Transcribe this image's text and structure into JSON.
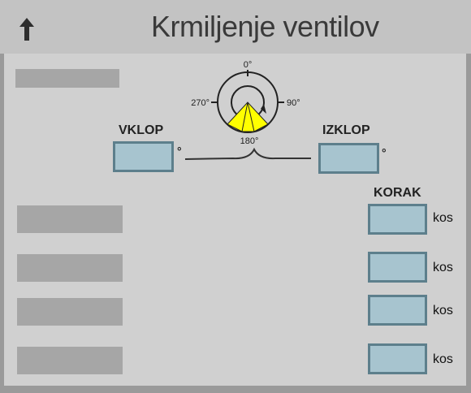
{
  "header": {
    "title": "Krmiljenje ventilov",
    "back_icon": "up-arrow-icon"
  },
  "dial": {
    "label_0": "0°",
    "label_90": "90°",
    "label_180": "180°",
    "label_270": "270°",
    "sector_color": "#ffff00"
  },
  "on": {
    "label": "VKLOP",
    "value": "",
    "unit": "°"
  },
  "off": {
    "label": "IZKLOP",
    "value": "",
    "unit": "°"
  },
  "step": {
    "header": "KORAK",
    "rows": [
      {
        "value": "",
        "unit": "kos"
      },
      {
        "value": "",
        "unit": "kos"
      },
      {
        "value": "",
        "unit": "kos"
      },
      {
        "value": "",
        "unit": "kos"
      }
    ]
  },
  "colors": {
    "field_fill": "#a7c4cf",
    "field_border": "#5d7f8c",
    "panel": "#d0d0d0",
    "frame": "#9a9a9a"
  }
}
